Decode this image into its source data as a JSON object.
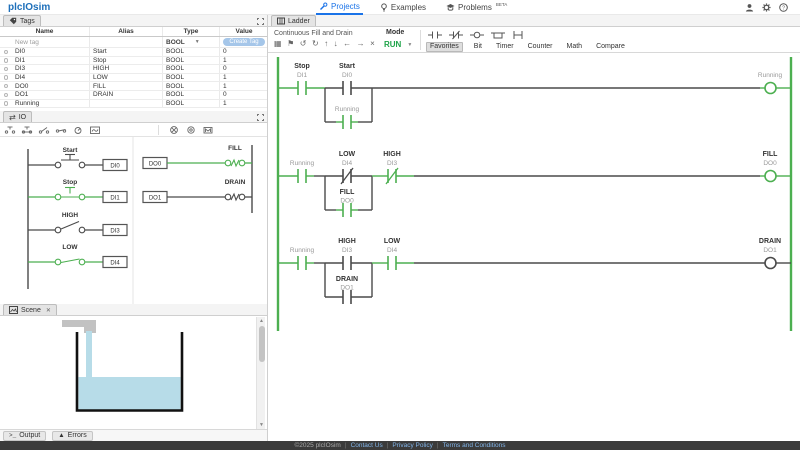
{
  "header": {
    "logo": "plcIOsim",
    "nav": {
      "projects": "Projects",
      "examples": "Examples",
      "problems": "Problems",
      "problems_badge": "BETA"
    }
  },
  "tags": {
    "tab": "Tags",
    "columns": {
      "name": "Name",
      "alias": "Alias",
      "type": "Type",
      "value": "Value"
    },
    "new_row": {
      "placeholder": "New tag",
      "type": "BOOL",
      "button": "Create Tag"
    },
    "rows": [
      {
        "name": "DI0",
        "alias": "Start",
        "type": "BOOL",
        "value": "0"
      },
      {
        "name": "DI1",
        "alias": "Stop",
        "type": "BOOL",
        "value": "1"
      },
      {
        "name": "DI3",
        "alias": "HIGH",
        "type": "BOOL",
        "value": "0"
      },
      {
        "name": "DI4",
        "alias": "LOW",
        "type": "BOOL",
        "value": "1"
      },
      {
        "name": "DO0",
        "alias": "FILL",
        "type": "BOOL",
        "value": "1"
      },
      {
        "name": "DO1",
        "alias": "DRAIN",
        "type": "BOOL",
        "value": "0"
      },
      {
        "name": "Running",
        "alias": "",
        "type": "BOOL",
        "value": "1"
      }
    ]
  },
  "io": {
    "tab": "IO",
    "inputs": [
      {
        "label": "Start",
        "address": "DI0",
        "state": "off"
      },
      {
        "label": "Stop",
        "address": "DI1",
        "state": "on"
      },
      {
        "label": "HIGH",
        "address": "DI3",
        "state": "off"
      },
      {
        "label": "LOW",
        "address": "DI4",
        "state": "on"
      }
    ],
    "outputs": [
      {
        "label": "FILL",
        "address": "DO0",
        "state": "on"
      },
      {
        "label": "DRAIN",
        "address": "DO1",
        "state": "off"
      }
    ]
  },
  "scene": {
    "tab": "Scene"
  },
  "ladder": {
    "tab": "Ladder",
    "title": "Continuous Fill and Drain",
    "mode_label": "Mode",
    "mode_value": "RUN",
    "categories": [
      "Favorites",
      "Bit",
      "Timer",
      "Counter",
      "Math",
      "Compare"
    ],
    "active_category": "Favorites",
    "rungs": [
      {
        "c1": "Stop",
        "a1": "DI1",
        "c2": "Start",
        "a2": "DI0",
        "branch": "Running",
        "branch_addr": "",
        "coil": "Running",
        "coil_addr": ""
      },
      {
        "c1": "Running",
        "a1": "",
        "c2": "LOW",
        "a2": "DI4",
        "c3": "HIGH",
        "a3": "DI3",
        "branch": "FILL",
        "branch_addr": "DO0",
        "coil": "FILL",
        "coil_addr": "DO0"
      },
      {
        "c1": "Running",
        "a1": "",
        "c2": "HIGH",
        "a2": "DI3",
        "c3": "LOW",
        "a3": "DI4",
        "branch": "DRAIN",
        "branch_addr": "DO1",
        "coil": "DRAIN",
        "coil_addr": "DO1"
      }
    ]
  },
  "console": {
    "output": "Output",
    "errors": "Errors"
  },
  "footer": {
    "copyright": "©2025 plcIOsim",
    "separator": "|",
    "links": [
      "Contact Us",
      "Privacy Policy",
      "Terms and Conditions"
    ]
  },
  "colors": {
    "logo_blue": "#1d6fba",
    "nav_active_blue": "#1a73e8",
    "run_green": "#1fa44a",
    "ladder_green": "#4caf50",
    "wire_dark": "#4a4a4a",
    "water_blue": "#b7dce8",
    "create_tag_bg": "#a5c6e9",
    "footer_bg": "#3b3b3b"
  }
}
